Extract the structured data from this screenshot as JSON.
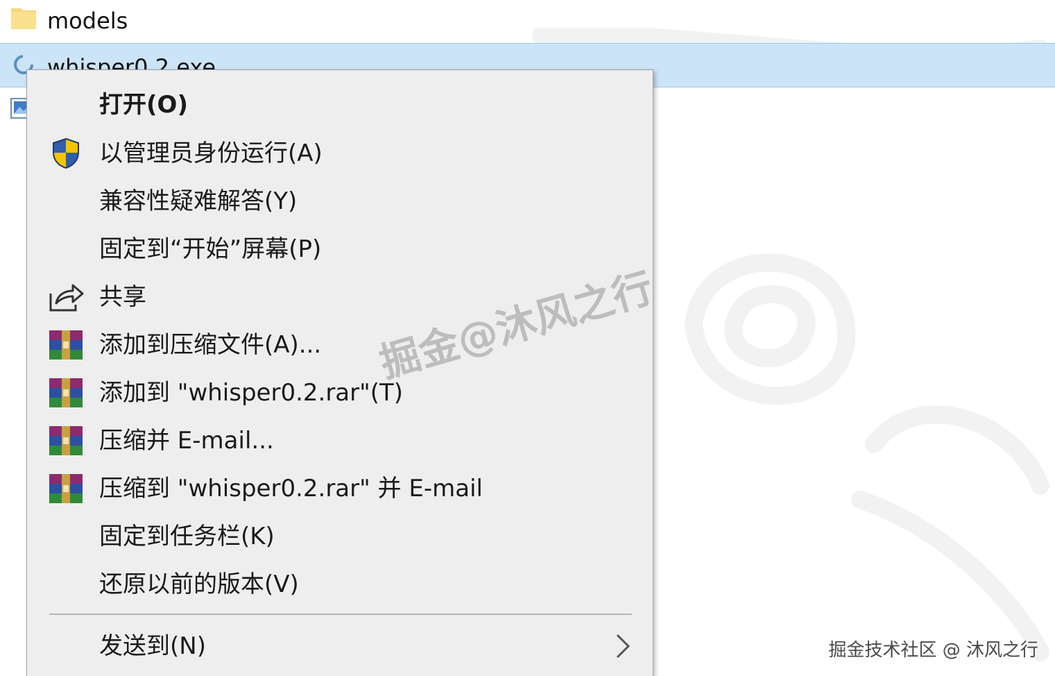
{
  "files": [
    {
      "name": "models",
      "icon": "folder-icon"
    },
    {
      "name": "whisper0.2.exe",
      "icon": "exe-app-icon",
      "selected": true
    },
    {
      "name": "",
      "icon": "image-file-icon"
    }
  ],
  "context_menu": {
    "items": [
      {
        "label": "打开(O)",
        "icon": null,
        "bold": true
      },
      {
        "label": "以管理员身份运行(A)",
        "icon": "uac-shield-icon"
      },
      {
        "label": "兼容性疑难解答(Y)",
        "icon": null
      },
      {
        "label": "固定到“开始”屏幕(P)",
        "icon": null
      },
      {
        "label": "共享",
        "icon": "share-icon"
      },
      {
        "label": "添加到压缩文件(A)...",
        "icon": "winrar-icon"
      },
      {
        "label": "添加到 \"whisper0.2.rar\"(T)",
        "icon": "winrar-icon"
      },
      {
        "label": "压缩并 E-mail...",
        "icon": "winrar-icon"
      },
      {
        "label": "压缩到 \"whisper0.2.rar\" 并 E-mail",
        "icon": "winrar-icon"
      },
      {
        "label": "固定到任务栏(K)",
        "icon": null
      },
      {
        "label": "还原以前的版本(V)",
        "icon": null
      },
      {
        "label": "发送到(N)",
        "icon": null,
        "submenu": true
      }
    ]
  },
  "watermarks": {
    "center": "掘金@沐风之行",
    "corner": "掘金技术社区 @ 沐风之行"
  },
  "colors": {
    "selection_bg": "#cce4f7",
    "selection_border": "#99c9ef",
    "menu_bg": "#eeeeee",
    "folder": "#f8d775"
  }
}
